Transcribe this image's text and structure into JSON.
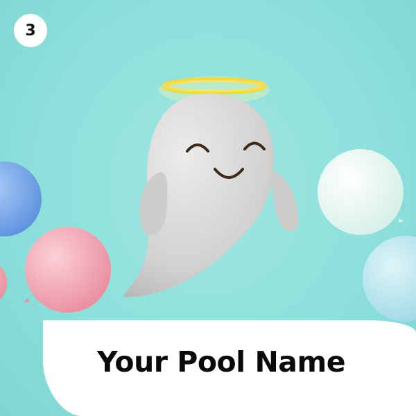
{
  "badge": {
    "number": "3"
  },
  "title": "Your Pool Name",
  "colors": {
    "background": "#8ee0dc",
    "ghost_body": "#d9d7d6",
    "halo": "#f3e04a",
    "face": "#3a2a1a",
    "balloon_blue": "#6ea4ea",
    "balloon_pink": "#f2a6b4",
    "balloon_white": "#eef9f6",
    "balloon_light_blue": "#b6e6ef",
    "banner": "#ffffff"
  },
  "icons": [
    "ghost-character",
    "halo-icon",
    "balloon-icon"
  ]
}
